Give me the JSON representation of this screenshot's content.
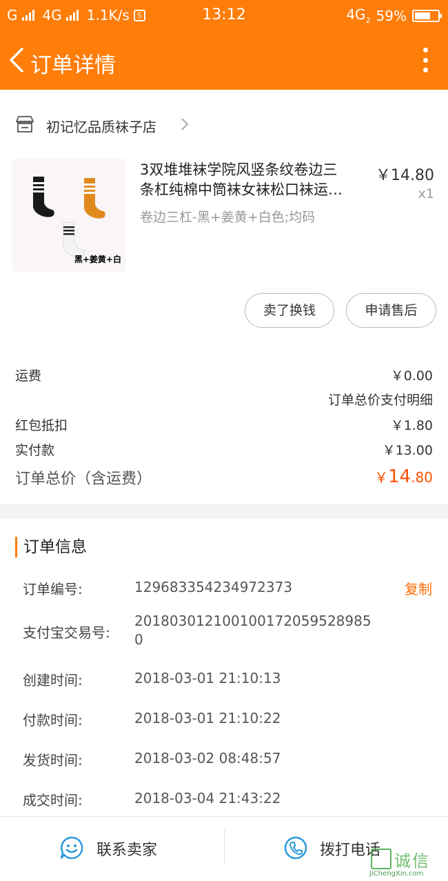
{
  "status_bar": {
    "carrier": "G",
    "network": "4G",
    "speed": "1.1K/s",
    "s_badge": "S",
    "time": "13:12",
    "network_right": "4G",
    "network_right_sub": "2",
    "battery": "59%"
  },
  "header": {
    "title": "订单详情"
  },
  "shop": {
    "name": "初记忆品质袜子店"
  },
  "product": {
    "title_line1": "3双堆堆袜学院风竖条纹卷边三",
    "title_line2": "条杠纯棉中筒袜女袜松口袜运…",
    "sku": "卷边三杠-黑+姜黄+白色;均码",
    "price": "￥14.80",
    "quantity": "x1",
    "image_caption": "黑+姜黄+白",
    "sock_colors": [
      "#1a1a1a",
      "#e08a1e",
      "#f4f4f4"
    ]
  },
  "actions": {
    "sell_label": "卖了换钱",
    "after_sale_label": "申请售后"
  },
  "fees": {
    "shipping_label": "运费",
    "shipping_value": "￥0.00",
    "price_detail_link": "订单总价支付明细",
    "redpacket_label": "红包抵扣",
    "redpacket_value": "￥1.80",
    "paid_label": "实付款",
    "paid_value": "￥13.00",
    "total_label": "订单总价（含运费）",
    "total_currency": "￥",
    "total_int": "14",
    "total_dec": ".80"
  },
  "order_info": {
    "section_title": "订单信息",
    "order_no_label": "订单编号:",
    "order_no": "129683354234972373",
    "copy_label": "复制",
    "alipay_label": "支付宝交易号:",
    "alipay_no": "2018030121001001720595289850",
    "created_label": "创建时间:",
    "created": "2018-03-01 21:10:13",
    "paid_label": "付款时间:",
    "paid": "2018-03-01 21:10:22",
    "shipped_label": "发货时间:",
    "shipped": "2018-03-02 08:48:57",
    "closed_label": "成交时间:",
    "closed": "2018-03-04 21:43:22"
  },
  "bottom_bar": {
    "contact_label": "联系卖家",
    "call_label": "拨打电话"
  },
  "watermark": {
    "text": "诚信",
    "url": "JiChengXin.com"
  },
  "colors": {
    "brand": "#ff7d09",
    "accent_price": "#ff5000",
    "icon_blue": "#2a9ad8"
  }
}
